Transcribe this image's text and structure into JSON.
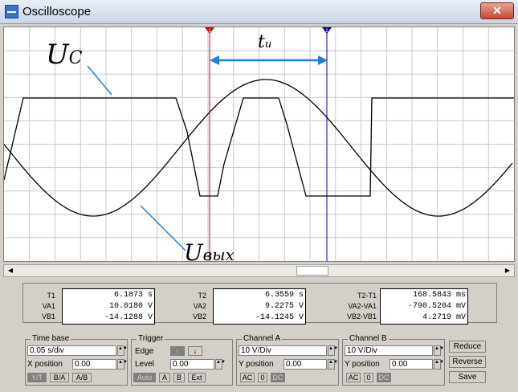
{
  "window": {
    "title": "Oscilloscope"
  },
  "annotations": {
    "uc": "U",
    "uc_sub": "C",
    "uvyx": "U",
    "uvyx_sub": "вых",
    "ti": "t",
    "ti_sub": "и"
  },
  "cursors": {
    "t1_marker": "1",
    "t2_marker": "2"
  },
  "readout": {
    "t1_label": "T1",
    "va1_label": "VA1",
    "vb1_label": "VB1",
    "t1": "6.1873",
    "t1_unit": "s",
    "va1": "10.0180",
    "va1_unit": "V",
    "vb1": "-14.1288",
    "vb1_unit": "V",
    "t2_label": "T2",
    "va2_label": "VA2",
    "vb2_label": "VB2",
    "t2": "6.3559",
    "t2_unit": "s",
    "va2": "9.2275",
    "va2_unit": "V",
    "vb2": "-14.1245",
    "vb2_unit": "V",
    "dt_label": "T2-T1",
    "dva_label": "VA2-VA1",
    "dvb_label": "VB2-VB1",
    "dt": "168.5843",
    "dt_unit": "ms",
    "dva": "-790.5204",
    "dva_unit": "mV",
    "dvb": "4.2719",
    "dvb_unit": "mV"
  },
  "timebase": {
    "title": "Time base",
    "scale": "0.05 s/div",
    "xpos_label": "X position",
    "xpos": "0.00",
    "yt": "Y/T",
    "ba": "B/A",
    "ab": "A/B"
  },
  "trigger": {
    "title": "Trigger",
    "edge_label": "Edge",
    "level_label": "Level",
    "level": "0.00",
    "auto": "Auto",
    "a": "A",
    "b": "B",
    "ext": "Ext"
  },
  "channel_a": {
    "title": "Channel A",
    "scale": "10 V/Div",
    "ypos_label": "Y position",
    "ypos": "0.00",
    "ac": "AC",
    "zero": "0",
    "dc": "DC"
  },
  "channel_b": {
    "title": "Channel B",
    "scale": "10 V/Div",
    "ypos_label": "Y position",
    "ypos": "0.00",
    "ac": "AC",
    "zero": "0",
    "dc": "DC"
  },
  "buttons": {
    "reduce": "Reduce",
    "reverse": "Reverse",
    "save": "Save"
  }
}
